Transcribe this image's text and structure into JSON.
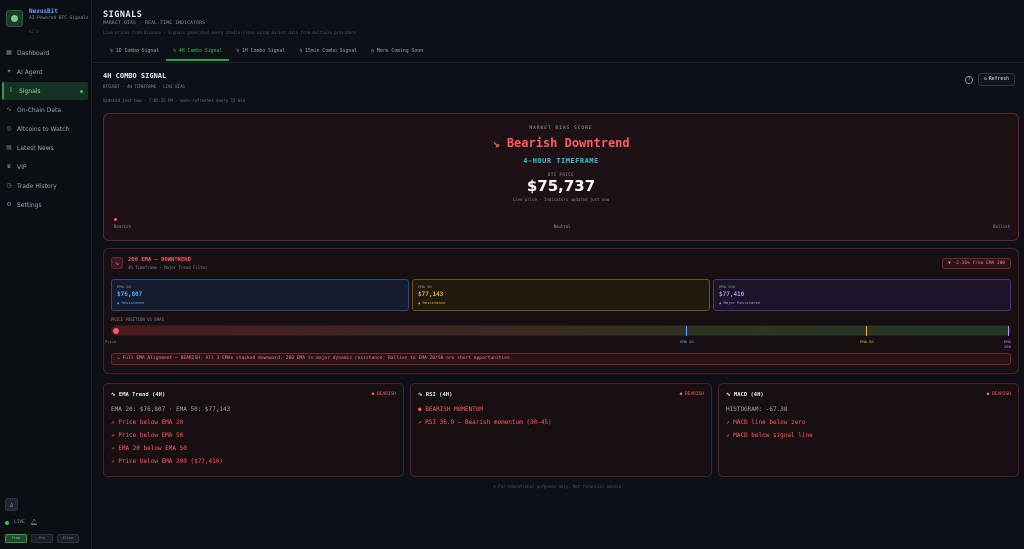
{
  "brand": {
    "name": "NexusBit",
    "subtitle": "AI-Powered BTC Signals",
    "version": "v2.0"
  },
  "sidebar": {
    "items": [
      {
        "label": "Dashboard",
        "icon": "grid-icon"
      },
      {
        "label": "AI Agent",
        "icon": "sparkle-icon"
      },
      {
        "label": "Signals",
        "icon": "signal-icon",
        "active": true
      },
      {
        "label": "On-Chain Data",
        "icon": "activity-icon"
      },
      {
        "label": "Altcoins to Watch",
        "icon": "coins-icon"
      },
      {
        "label": "Latest News",
        "icon": "news-icon"
      },
      {
        "label": "VIP",
        "icon": "crown-icon"
      },
      {
        "label": "Trade History",
        "icon": "history-icon"
      },
      {
        "label": "Settings",
        "icon": "gear-icon"
      }
    ],
    "live_label": "LIVE",
    "modes": [
      "Free",
      "Pro",
      "Elite"
    ]
  },
  "header": {
    "title": "SIGNALS",
    "subtitle": "MARKET BIAS · REAL-TIME INDICATORS",
    "description": "Live prices from Binance · Signals generated every candle-close using market data from multiple providers",
    "tabs": [
      {
        "label": "1D Combo Signal"
      },
      {
        "label": "4H Combo Signal",
        "active": true
      },
      {
        "label": "1H Combo Signal"
      },
      {
        "label": "15min Combo Signal"
      },
      {
        "label": "More Coming Soon"
      }
    ]
  },
  "section": {
    "title": "4H COMBO SIGNAL",
    "subtitle": "BTCUSDT · 4H TIMEFRAME · LIVE BIAS",
    "updated": "Updated just now · 7:05:15 PM · auto-refreshes every 15 min",
    "refresh_label": "Refresh"
  },
  "hero": {
    "label": "MARKET BIAS SCORE",
    "headline": "Bearish Downtrend",
    "timeframe": "4-HOUR TIMEFRAME",
    "price_label": "BTC PRICE",
    "price": "$75,737",
    "note": "Live price · Indicators updated just now",
    "scale": [
      "Bearish",
      "Neutral",
      "Bullish"
    ]
  },
  "ema": {
    "title": "200 EMA — DOWNTREND",
    "subtitle": "4h Timeframe · Major Trend Filter",
    "badge": "▼ -2.16% from EMA 200",
    "boxes": [
      {
        "label": "EMA 20",
        "value": "$76,807",
        "position": "▲ Resistance"
      },
      {
        "label": "EMA 50",
        "value": "$77,143",
        "position": "▲ Resistance"
      },
      {
        "label": "EMA 200",
        "value": "$77,410",
        "position": "▲ Major Resistance"
      }
    ],
    "position_label": "PRICE POSITION VS EMAS",
    "scale": {
      "price": "Price",
      "ema20": "EMA 20",
      "ema50": "EMA 50",
      "ema200": "EMA 200"
    },
    "message": "↘ Full EMA Alignment — BEARISH. All 3 EMAs stacked downward. 200 EMA is major dynamic resistance. Rallies to EMA 20/50 are short opportunities."
  },
  "cards": {
    "trend": {
      "title": "EMA Trend (4H)",
      "badge": "● BEARISH",
      "main": "EMA 20: $76,807 · EMA 50: $77,143",
      "items": [
        "↗ Price below EMA 20",
        "↗ Price below EMA 50",
        "↗ EMA 20 below EMA 50",
        "↗ Price below EMA 200 ($77,410)"
      ]
    },
    "rsi": {
      "title": "RSI (4H)",
      "badge": "● BEARISH",
      "main": "BEARISH MOMENTUM",
      "items": [
        "↗ RSI 36.0 — Bearish momentum (30-45)"
      ]
    },
    "macd": {
      "title": "MACD (4H)",
      "badge": "● BEARISH",
      "main": "HISTOGRAM: -67.38",
      "items": [
        "↗ MACD line below zero",
        "↗ MACD below signal line"
      ]
    }
  },
  "footer": "© For educational purposes only. Not financial advice.",
  "colors": {
    "bearish": "#ff5c63",
    "accent": "#2ea043",
    "cyan": "#39c5cf"
  }
}
